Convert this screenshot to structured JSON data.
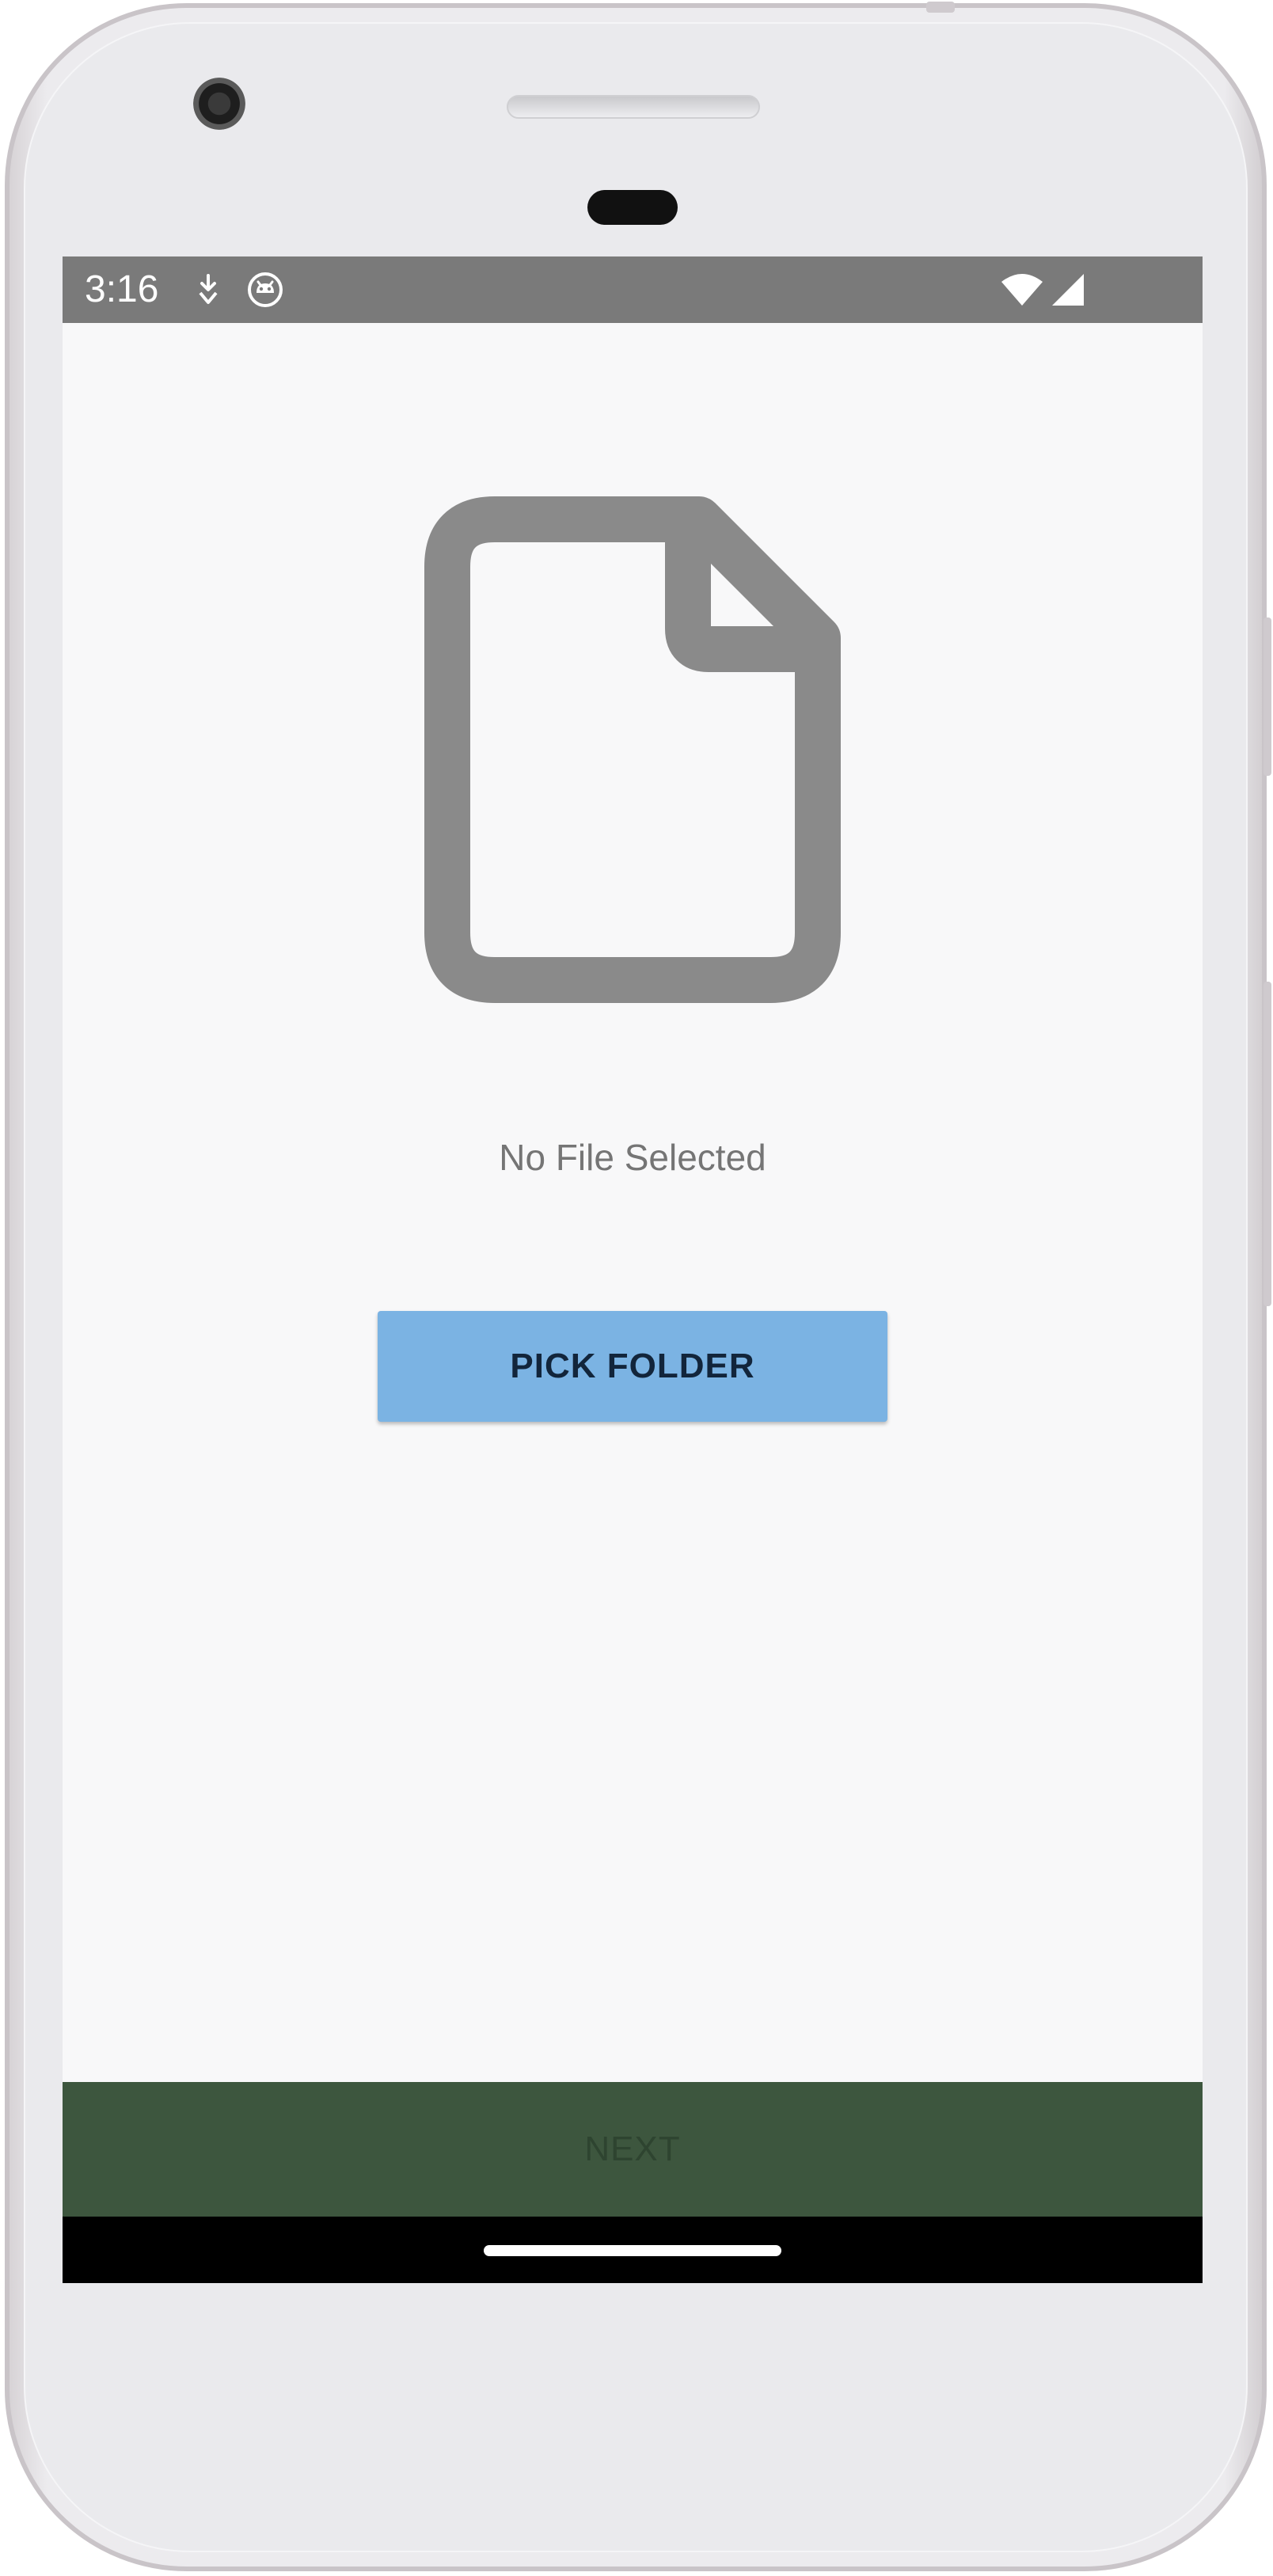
{
  "status_bar": {
    "time": "3:16",
    "icons": [
      "download-icon",
      "android-debug-icon",
      "wifi-icon",
      "cell-signal-icon"
    ]
  },
  "main": {
    "file_icon": "file-outline-icon",
    "status_text": "No File Selected",
    "pick_button_label": "PICK FOLDER"
  },
  "bottom": {
    "next_label": "NEXT"
  },
  "colors": {
    "status_bar": "#7a7a7a",
    "primary_button": "#7bb3e3",
    "next_bar": "#3d563e",
    "icon_gray": "#8a8a8a"
  }
}
